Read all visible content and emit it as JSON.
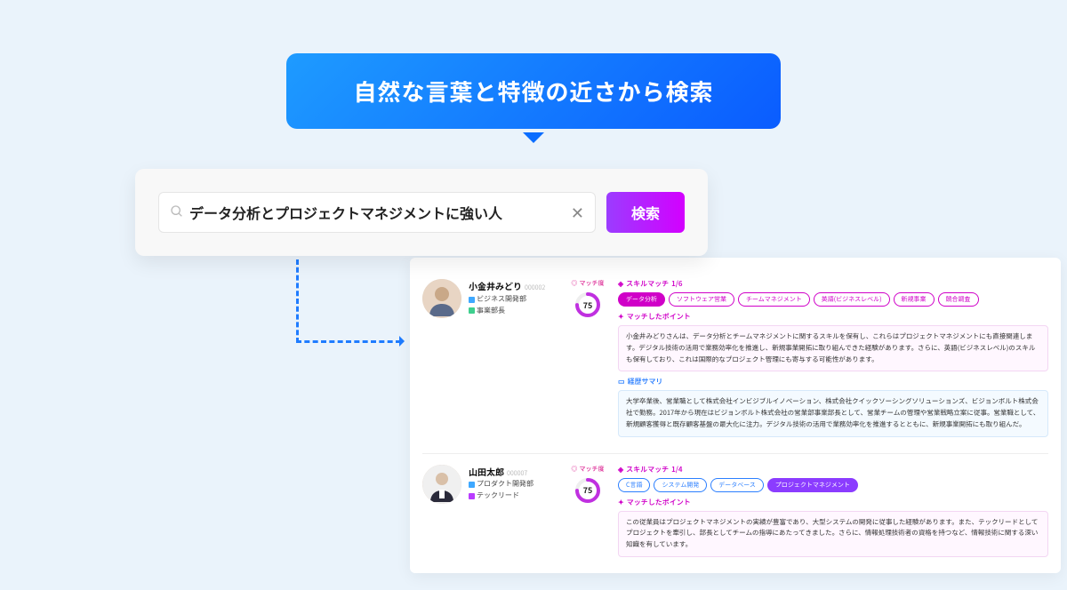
{
  "callout": {
    "text": "自然な言葉と特徴の近さから検索"
  },
  "search": {
    "value": "データ分析とプロジェクトマネジメントに強い人",
    "button": "検索"
  },
  "match_label": "マッチ度",
  "skill_match_label": "スキルマッチ",
  "matched_points_label": "マッチしたポイント",
  "career_summary_label": "経歴サマリ",
  "results": [
    {
      "name": "小金井みどり",
      "code": "000002",
      "dept": "ビジネス開発部",
      "role": "事業部長",
      "score": "75",
      "skill_ratio": "1/6",
      "tags": [
        {
          "label": "データ分析",
          "style": "fill"
        },
        {
          "label": "ソフトウェア営業",
          "style": ""
        },
        {
          "label": "チームマネジメント",
          "style": ""
        },
        {
          "label": "英語(ビジネスレベル)",
          "style": ""
        },
        {
          "label": "新規事業",
          "style": ""
        },
        {
          "label": "競合調査",
          "style": ""
        }
      ],
      "point_text": "小金井みどりさんは、データ分析とチームマネジメントに関するスキルを保有し、これらはプロジェクトマネジメントにも直接関連します。デジタル技術の活用で業務効率化を推進し、新規事業開拓に取り組んできた経験があります。さらに、英語(ビジネスレベル)のスキルも保有しており、これは国際的なプロジェクト管理にも寄与する可能性があります。",
      "career_text": "大学卒業後、営業職として株式会社インビジブルイノベーション、株式会社クイックソーシングソリューションズ、ビジョンボルト株式会社で勤務。2017年から現在はビジョンボルト株式会社の営業部事業部長として、営業チームの管理や営業戦略立案に従事。営業職として、新規顧客獲得と既存顧客基盤の最大化に注力。デジタル技術の活用で業務効率化を推進するとともに、新規事業開拓にも取り組んだ。"
    },
    {
      "name": "山田太郎",
      "code": "000007",
      "dept": "プロダクト開発部",
      "role": "テックリード",
      "score": "75",
      "skill_ratio": "1/4",
      "tags": [
        {
          "label": "C言語",
          "style": "blue"
        },
        {
          "label": "システム開発",
          "style": "blue"
        },
        {
          "label": "データベース",
          "style": "blue"
        },
        {
          "label": "プロジェクトマネジメント",
          "style": "fill-purple"
        }
      ],
      "point_text": "この従業員はプロジェクトマネジメントの実績が豊富であり、大型システムの開発に従事した経験があります。また、テックリードとしてプロジェクトを牽引し、部長としてチームの指導にあたってきました。さらに、情報処理技術者の資格を持つなど、情報技術に関する深い知識を有しています。"
    }
  ]
}
